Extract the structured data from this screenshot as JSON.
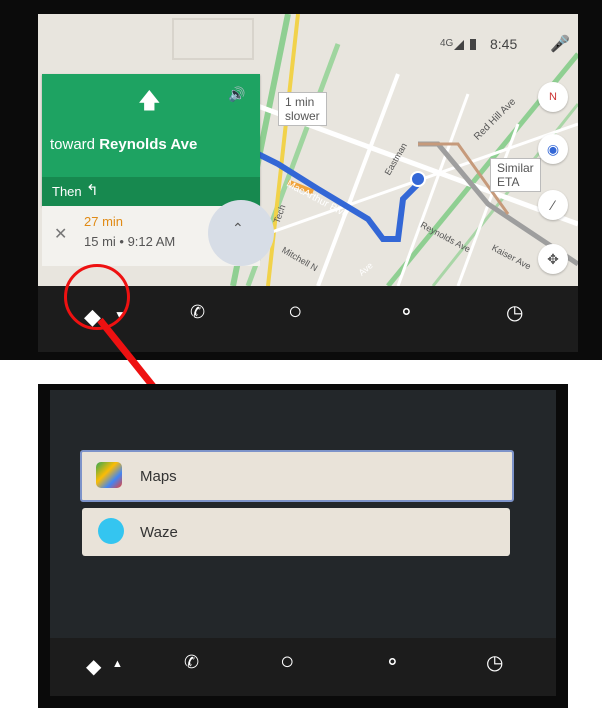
{
  "status_bar": {
    "time": "8:45",
    "network": "4G"
  },
  "navigation": {
    "direction": "toward",
    "street": "Reynolds Ave",
    "then_label": "Then"
  },
  "eta": {
    "duration": "27 min",
    "details": "15 mi • 9:12 AM"
  },
  "map": {
    "callout_slower": "1 min\nslower",
    "callout_similar": "Similar\nETA",
    "street_labels": [
      "Eastman",
      "MacArthur Blvd",
      "Reynolds Ave",
      "Red Hill Ave",
      "Kaiser Ave",
      "Mitchell N",
      "Tech",
      "Ave"
    ]
  },
  "apps_menu": {
    "items": [
      "Maps",
      "Waze"
    ],
    "selected": "Maps"
  },
  "colors": {
    "nav_green": "#1ea362",
    "route_blue": "#3367d6",
    "annotation_red": "#e11111",
    "waze_blue": "#34c5f0"
  },
  "icons": [
    "nav-icon",
    "phone-icon",
    "home-icon",
    "headphones-icon",
    "recent-icon",
    "mic-icon",
    "compass-icon",
    "location-icon",
    "zoom-out-icon",
    "recenter-icon",
    "volume-icon",
    "up-arrow-icon",
    "turn-left-icon"
  ]
}
